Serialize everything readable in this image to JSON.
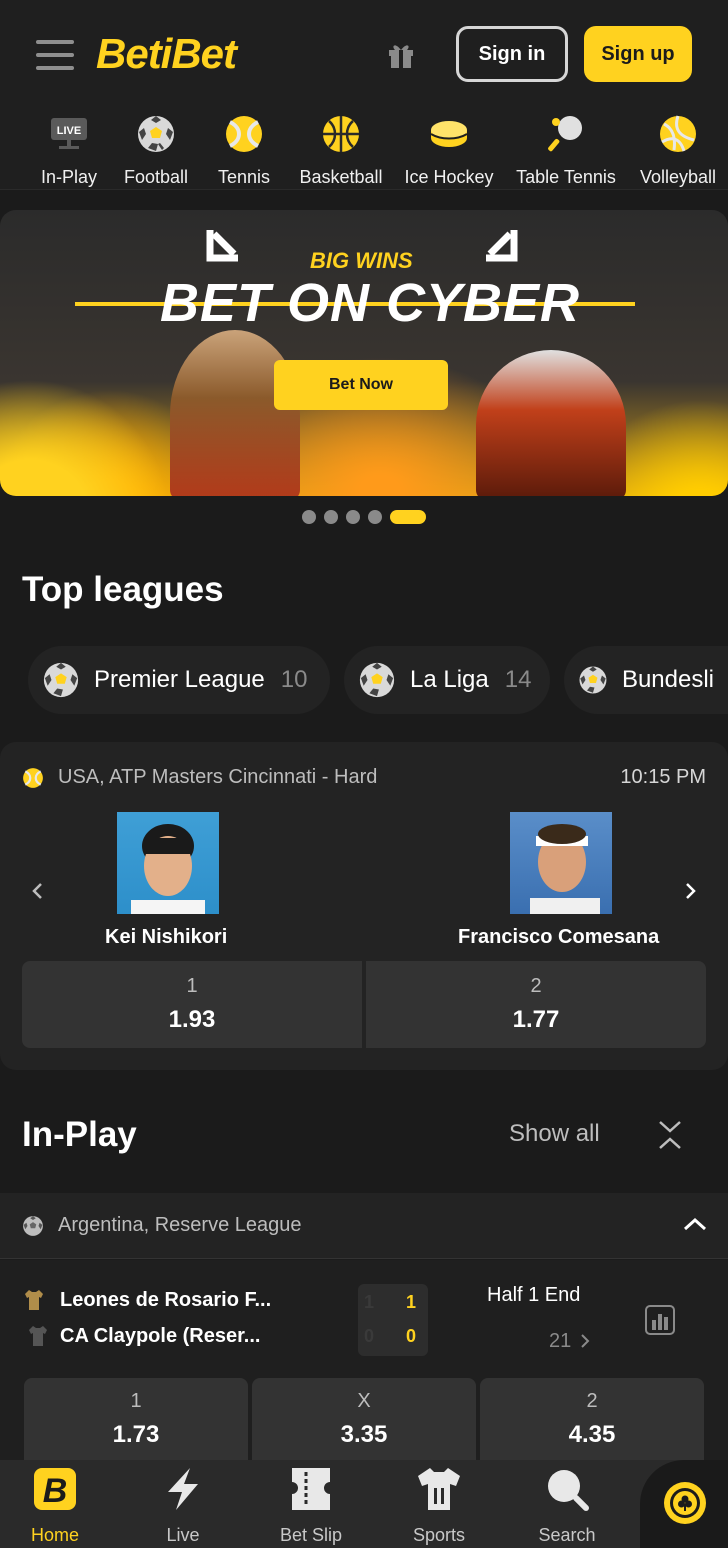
{
  "header": {
    "logo_text": "BetiBet",
    "signin_label": "Sign in",
    "signup_label": "Sign up",
    "accent": "#ffd21f"
  },
  "sports_nav": [
    {
      "label": "In-Play",
      "icon": "live-icon"
    },
    {
      "label": "Football",
      "icon": "football-icon"
    },
    {
      "label": "Tennis",
      "icon": "tennis-icon"
    },
    {
      "label": "Basketball",
      "icon": "basketball-icon"
    },
    {
      "label": "Ice Hockey",
      "icon": "ice-hockey-icon"
    },
    {
      "label": "Table Tennis",
      "icon": "table-tennis-icon"
    },
    {
      "label": "Volleyball",
      "icon": "volleyball-icon"
    }
  ],
  "banner": {
    "kicker": "BIG WINS",
    "headline": "BET ON CYBER",
    "cta_label": "Bet Now",
    "slides_total": 5,
    "active_slide": 5
  },
  "top_leagues": {
    "title": "Top leagues",
    "items": [
      {
        "name": "Premier League",
        "count": "10"
      },
      {
        "name": "La Liga",
        "count": "14"
      },
      {
        "name": "Bundesli",
        "count": ""
      }
    ]
  },
  "featured_match": {
    "league": "USA, ATP Masters Cincinnati - Hard",
    "time": "10:15 PM",
    "player1": "Kei Nishikori",
    "player2": "Francisco Comesana",
    "odds": [
      {
        "label": "1",
        "value": "1.93"
      },
      {
        "label": "2",
        "value": "1.77"
      }
    ]
  },
  "in_play": {
    "title": "In-Play",
    "show_all_label": "Show all",
    "league": "Argentina, Reserve League",
    "match": {
      "team1": "Leones de Rosario F...",
      "team2": "CA Claypole (Reser...",
      "score1_prev": "1",
      "score1": "1",
      "score2_prev": "0",
      "score2": "0",
      "status": "Half 1 End",
      "markets": "21"
    },
    "odds": [
      {
        "label": "1",
        "value": "1.73"
      },
      {
        "label": "X",
        "value": "3.35"
      },
      {
        "label": "2",
        "value": "4.35"
      }
    ]
  },
  "bottom_nav": [
    {
      "label": "Home",
      "icon": "home-icon",
      "active": true
    },
    {
      "label": "Live",
      "icon": "lightning-icon",
      "active": false
    },
    {
      "label": "Bet Slip",
      "icon": "betslip-icon",
      "active": false
    },
    {
      "label": "Sports",
      "icon": "jersey-icon",
      "active": false
    },
    {
      "label": "Search",
      "icon": "search-icon",
      "active": false
    }
  ]
}
